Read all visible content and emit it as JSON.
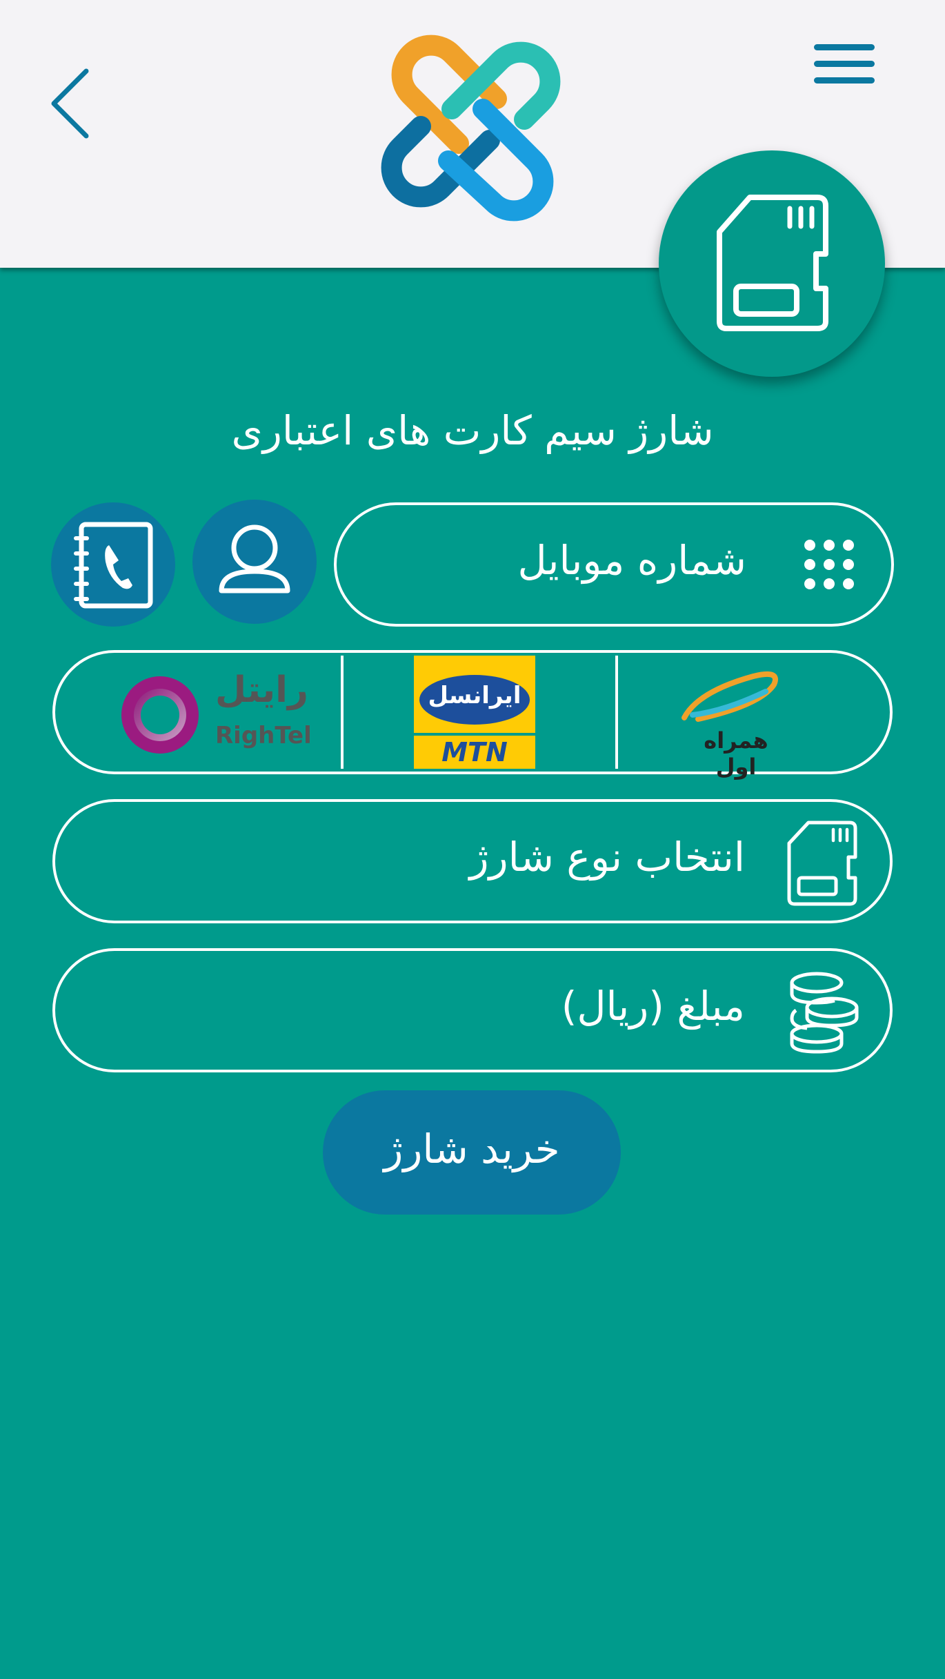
{
  "title": "شارژ سیم کارت های اعتباری",
  "mobile_field": {
    "label": "شماره موبایل",
    "icon": "dialpad-icon"
  },
  "contact_buttons": [
    {
      "icon": "user-icon"
    },
    {
      "icon": "phonebook-icon"
    }
  ],
  "operators": [
    {
      "name": "hamrah-aval",
      "logo_text": "همراه اول"
    },
    {
      "name": "irancell",
      "logo_text": "ایرانسل",
      "logo_subtext": "MTN"
    },
    {
      "name": "rightel",
      "logo_text": "رایتل",
      "logo_subtext": "RighTel"
    }
  ],
  "charge_type_field": {
    "label": "انتخاب نوع شارژ",
    "icon": "sim-card-icon"
  },
  "amount_field": {
    "label": "مبلغ (ریال)",
    "icon": "coins-icon"
  },
  "buy_button": {
    "label": "خرید شارژ"
  },
  "colors": {
    "main": "#009b8c",
    "header": "#f4f3f6",
    "button": "#0b78a0",
    "logo_orange": "#f0a12a",
    "logo_teal": "#2bbfb3",
    "logo_darkblue": "#0d6fa0",
    "logo_blue": "#1a9ee0"
  }
}
